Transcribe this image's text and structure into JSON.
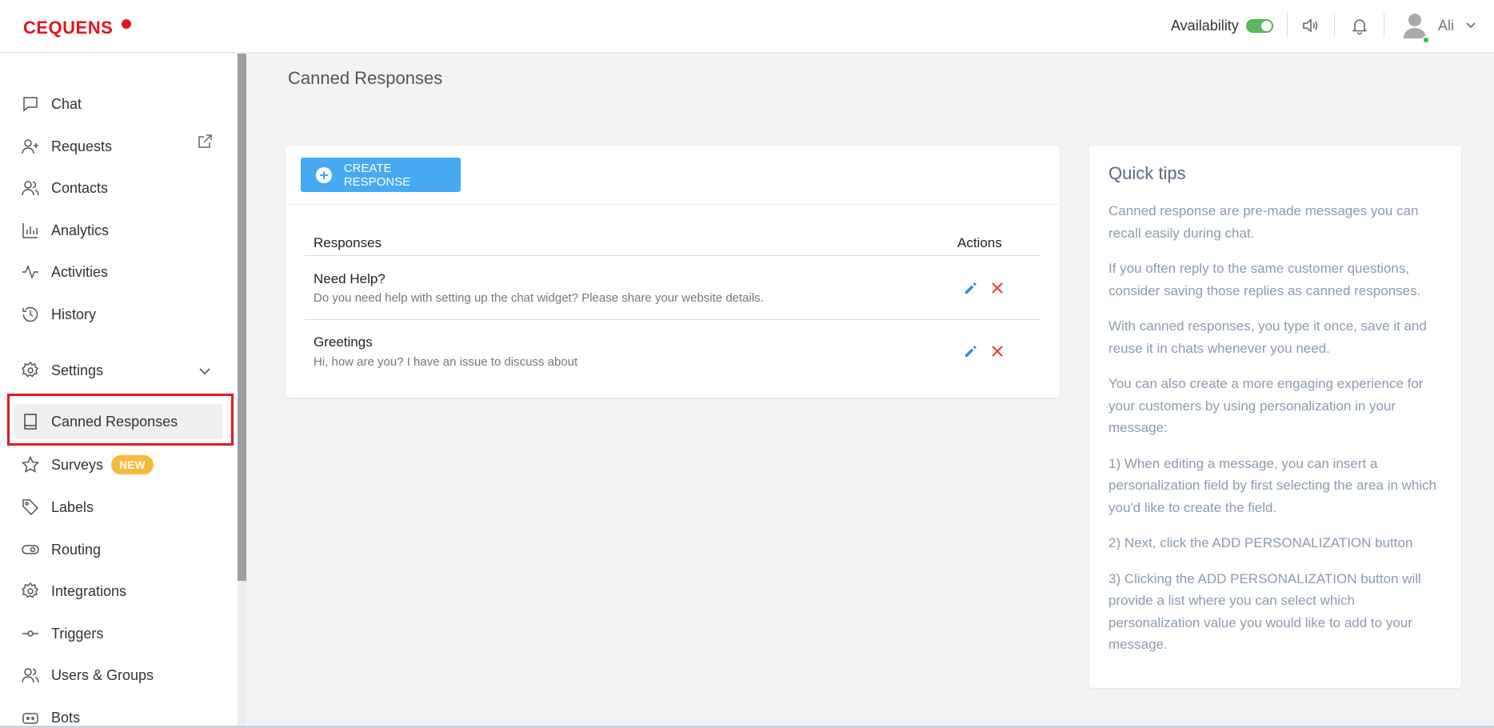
{
  "header": {
    "logo": "CEQUENS",
    "availability_label": "Availability",
    "user_name": "Ali"
  },
  "sidebar": {
    "items": [
      {
        "label": "Chat",
        "icon": "chat-icon"
      },
      {
        "label": "Requests",
        "icon": "user-plus-icon"
      },
      {
        "label": "Contacts",
        "icon": "contacts-icon"
      },
      {
        "label": "Analytics",
        "icon": "bar-chart-icon"
      },
      {
        "label": "Activities",
        "icon": "activity-icon"
      },
      {
        "label": "History",
        "icon": "history-icon"
      }
    ],
    "settings": {
      "label": "Settings",
      "icon": "gear-icon"
    },
    "sub_items": [
      {
        "label": "Canned Responses",
        "icon": "book-icon",
        "active": true
      },
      {
        "label": "Surveys",
        "icon": "star-icon",
        "badge": "NEW"
      },
      {
        "label": "Labels",
        "icon": "tag-icon"
      },
      {
        "label": "Routing",
        "icon": "toggle-icon"
      },
      {
        "label": "Integrations",
        "icon": "gear-icon"
      },
      {
        "label": "Triggers",
        "icon": "trigger-icon"
      },
      {
        "label": "Users & Groups",
        "icon": "users-icon"
      },
      {
        "label": "Bots",
        "icon": "bot-icon"
      }
    ]
  },
  "main": {
    "title": "Canned Responses",
    "create_button": "CREATE RESPONSE",
    "table": {
      "col_responses": "Responses",
      "col_actions": "Actions",
      "rows": [
        {
          "title": "Need Help?",
          "text": "Do you need help with setting up the chat widget? Please share your website details."
        },
        {
          "title": "Greetings",
          "text": "Hi, how are you? I have an issue to discuss about"
        }
      ]
    }
  },
  "tips": {
    "title": "Quick tips",
    "paragraphs": [
      "Canned response are pre-made messages you can recall easily during chat.",
      "If you often reply to the same customer questions, consider saving those replies as canned responses.",
      "With canned responses, you type it once, save it and reuse it in chats whenever you need.",
      "You can also create a more engaging experience for your customers by using personalization in your message:",
      "1) When editing a message, you can insert a personalization field by first selecting the area in which you'd like to create the field.",
      "2) Next, click the ADD PERSONALIZATION button",
      "3) Clicking the ADD PERSONALIZATION button will provide a list where you can select which personalization value you would like to add to your message."
    ]
  },
  "colors": {
    "brand": "#e3151b",
    "primary_button": "#45aaf2",
    "delete_icon": "#e53935",
    "edit_icon": "#2f8fdc",
    "badge_new": "#f6b93b",
    "toggle_on": "#5cb85c"
  }
}
